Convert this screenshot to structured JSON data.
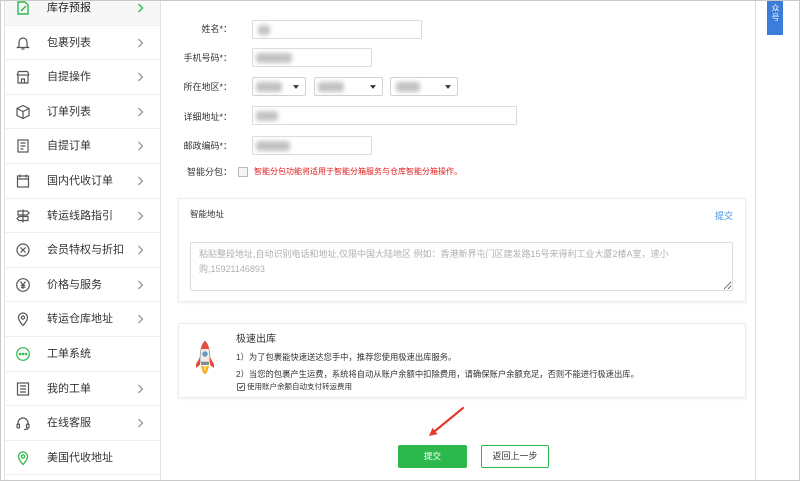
{
  "sidebar": {
    "items": [
      {
        "label": "库存预报",
        "icon": "edit-document-icon",
        "active": true
      },
      {
        "label": "包裹列表",
        "icon": "bell-icon"
      },
      {
        "label": "自提操作",
        "icon": "store-icon"
      },
      {
        "label": "订单列表",
        "icon": "box-icon"
      },
      {
        "label": "自提订单",
        "icon": "document-icon"
      },
      {
        "label": "国内代收订单",
        "icon": "calendar-icon"
      },
      {
        "label": "转运线路指引",
        "icon": "signpost-icon"
      },
      {
        "label": "会员特权与折扣",
        "icon": "discount-icon"
      },
      {
        "label": "价格与服务",
        "icon": "yen-icon"
      },
      {
        "label": "转运仓库地址",
        "icon": "location-icon"
      },
      {
        "label": "工单系统",
        "icon": "chat-dots-icon"
      },
      {
        "label": "我的工单",
        "icon": "ticket-list-icon"
      },
      {
        "label": "在线客服",
        "icon": "headset-icon"
      },
      {
        "label": "美国代收地址",
        "icon": "location-icon"
      }
    ]
  },
  "form": {
    "name": {
      "label": "姓名*："
    },
    "phone": {
      "label": "手机号码*："
    },
    "region": {
      "label": "所在地区*："
    },
    "address": {
      "label": "详细地址*："
    },
    "postcode": {
      "label": "邮政编码*："
    },
    "smart_split": {
      "label": "智能分包：",
      "checked": false,
      "note": "智能分包功能将适用于智能分箱服务与仓库智能分箱操作。"
    }
  },
  "smart_address": {
    "title": "智能地址",
    "submit_label": "提交",
    "placeholder": "粘贴整段地址,自动识别电话和地址,仅限中国大陆地区 例如：香港新界屯门区建发路15号来得利工业大厦2楼A室，速小购,15921146893"
  },
  "express_outbound": {
    "title": "极速出库",
    "lines": [
      "1）为了包裹能快速送达您手中，推荐您使用极速出库服务。",
      "2）当您的包裹产生运费，系统将自动从账户余额中扣除费用，请确保账户余额充足，否则不能进行极速出库。"
    ],
    "auto_pay": {
      "checked": true,
      "label": "使用账户余额自动支付转运费用"
    }
  },
  "actions": {
    "submit_label": "提交",
    "back_label": "返回上一步"
  },
  "side_tab": {
    "label": "众号"
  },
  "colors": {
    "accent": "#2db84d",
    "link": "#3a8ee6",
    "warning": "#e0201f",
    "side_tab": "#3b7dd8",
    "annotation_arrow": "#e53b2c"
  }
}
